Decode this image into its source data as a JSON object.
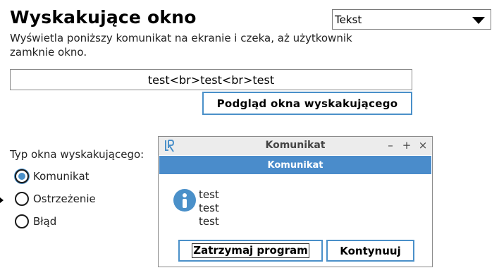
{
  "page": {
    "title": "Wyskakujące okno",
    "description": "Wyświetla poniższy komunikat na ekranie i czeka, aż użytkownik zamknie okno."
  },
  "mode_select": {
    "value": "Tekst",
    "icon": "chevron-down-icon"
  },
  "message_input": {
    "value": "test<br>test<br>test"
  },
  "preview_button": {
    "label": "Podgląd okna wyskakującego"
  },
  "popup_type": {
    "label": "Typ okna wyskakującego:",
    "options": [
      {
        "label": "Komunikat",
        "checked": true
      },
      {
        "label": "Ostrzeżenie",
        "checked": false
      },
      {
        "label": "Błąd",
        "checked": false
      }
    ],
    "accent_color": "#4a90c9"
  },
  "dialog": {
    "window_title": "Komunikat",
    "controls": {
      "minimize": "–",
      "maximize": "+",
      "close": "×"
    },
    "header": "Komunikat",
    "header_color": "#4a8ccb",
    "icon": "info-icon",
    "lines": [
      "test",
      "test",
      "test"
    ],
    "buttons": {
      "stop": "Zatrzymaj program",
      "continue": "Kontynuuj"
    }
  }
}
